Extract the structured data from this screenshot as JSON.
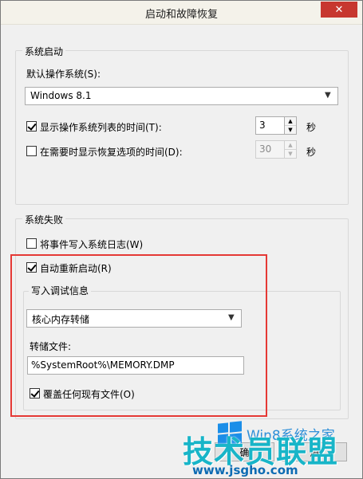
{
  "window": {
    "title": "启动和故障恢复",
    "close_glyph": "✕"
  },
  "startup": {
    "group_label": "系统启动",
    "default_os_label": "默认操作系统(S):",
    "default_os_value": "Windows 8.1",
    "show_list": {
      "label": "显示操作系统列表的时间(T):",
      "checked": true,
      "value": "3",
      "unit": "秒"
    },
    "show_recovery": {
      "label": "在需要时显示恢复选项的时间(D):",
      "checked": false,
      "value": "30",
      "unit": "秒"
    }
  },
  "failure": {
    "group_label": "系统失败",
    "write_event": {
      "label": "将事件写入系统日志(W)",
      "checked": false
    },
    "auto_restart": {
      "label": "自动重新启动(R)",
      "checked": true
    },
    "debug_info": {
      "group_label": "写入调试信息",
      "type_value": "核心内存转储",
      "dump_file_label": "转储文件:",
      "dump_file_value": "%SystemRoot%\\MEMORY.DMP",
      "overwrite": {
        "label": "覆盖任何现有文件(O)",
        "checked": true
      }
    }
  },
  "buttons": {
    "ok_partial": "确",
    "cancel_partial": "消"
  },
  "watermark": {
    "main": "技术员联盟",
    "sub": "Win8系统之家",
    "url": "www.jsgho.com"
  },
  "colors": {
    "highlight": "#e53935",
    "close_button": "#c7372f",
    "watermark_main": "#18b5c8",
    "watermark_url": "#0d6bb3"
  }
}
